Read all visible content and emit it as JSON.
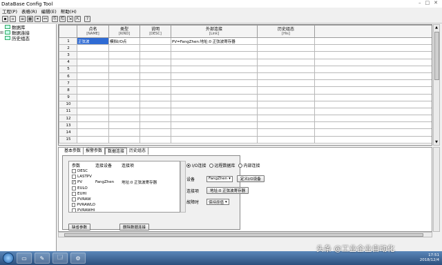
{
  "window": {
    "title": "DataBase Config Tool",
    "min": "–",
    "max": "□",
    "close": "✕"
  },
  "menu": [
    "工程(P)",
    "表格(R)",
    "编辑(E)",
    "帮助(H)"
  ],
  "toolbar_icons": [
    "save-icon",
    "print-icon",
    "list-icon",
    "grid-icon",
    "link-icon",
    "unlink-icon",
    "copy-icon",
    "paste-icon",
    "import-icon",
    "export-icon",
    "help-icon"
  ],
  "toolbar_glyphs": [
    "▪",
    "▫",
    "≡",
    "▦",
    "⚭",
    "⚯",
    "⎘",
    "⎗",
    "⇲",
    "⇱",
    "?"
  ],
  "tree": [
    {
      "label": "数据库",
      "expander": ""
    },
    {
      "label": "数据连接",
      "expander": "⊞"
    },
    {
      "label": "历史组态",
      "expander": ""
    }
  ],
  "grid": {
    "columns": [
      {
        "title": "点名",
        "sub": "[NAME]"
      },
      {
        "title": "类型",
        "sub": "[KIND]"
      },
      {
        "title": "说明",
        "sub": "[DESC]"
      },
      {
        "title": "外部连接",
        "sub": "[Link]"
      },
      {
        "title": "历史组态",
        "sub": "[His]"
      }
    ],
    "rows": [
      {
        "n": "1",
        "name": "正弦波",
        "kind": "模拟I/O点",
        "desc": "",
        "link": "PV=FangZhen:地址:0 正弦波寄存器",
        "his": ""
      },
      {
        "n": "2",
        "name": "",
        "kind": "",
        "desc": "",
        "link": "",
        "his": ""
      },
      {
        "n": "3",
        "name": "",
        "kind": "",
        "desc": "",
        "link": "",
        "his": ""
      },
      {
        "n": "4",
        "name": "",
        "kind": "",
        "desc": "",
        "link": "",
        "his": ""
      },
      {
        "n": "5",
        "name": "",
        "kind": "",
        "desc": "",
        "link": "",
        "his": ""
      },
      {
        "n": "6",
        "name": "",
        "kind": "",
        "desc": "",
        "link": "",
        "his": ""
      },
      {
        "n": "7",
        "name": "",
        "kind": "",
        "desc": "",
        "link": "",
        "his": ""
      },
      {
        "n": "8",
        "name": "",
        "kind": "",
        "desc": "",
        "link": "",
        "his": ""
      },
      {
        "n": "9",
        "name": "",
        "kind": "",
        "desc": "",
        "link": "",
        "his": ""
      },
      {
        "n": "10",
        "name": "",
        "kind": "",
        "desc": "",
        "link": "",
        "his": ""
      },
      {
        "n": "11",
        "name": "",
        "kind": "",
        "desc": "",
        "link": "",
        "his": ""
      },
      {
        "n": "12",
        "name": "",
        "kind": "",
        "desc": "",
        "link": "",
        "his": ""
      },
      {
        "n": "13",
        "name": "",
        "kind": "",
        "desc": "",
        "link": "",
        "his": ""
      },
      {
        "n": "14",
        "name": "",
        "kind": "",
        "desc": "",
        "link": "",
        "his": ""
      },
      {
        "n": "15",
        "name": "",
        "kind": "",
        "desc": "",
        "link": "",
        "his": ""
      }
    ]
  },
  "tabs": [
    "基本参数",
    "报警参数",
    "数据连接",
    "历史组态"
  ],
  "active_tab": 2,
  "params": {
    "headers": [
      "参数",
      "连接设备",
      "连接项"
    ],
    "rows": [
      {
        "name": "DESC",
        "checked": false,
        "device": "",
        "item": ""
      },
      {
        "name": "LASTPV",
        "checked": false,
        "device": "",
        "item": ""
      },
      {
        "name": "PV",
        "checked": true,
        "device": "FangZhen",
        "item": "地址:0 正弦波寄存器"
      },
      {
        "name": "EULO",
        "checked": false,
        "device": "",
        "item": ""
      },
      {
        "name": "EUHI",
        "checked": false,
        "device": "",
        "item": ""
      },
      {
        "name": "PVRAW",
        "checked": false,
        "device": "",
        "item": ""
      },
      {
        "name": "PVRAWLO",
        "checked": false,
        "device": "",
        "item": ""
      },
      {
        "name": "PVRAWHI",
        "checked": false,
        "device": "",
        "item": ""
      }
    ]
  },
  "link_type": {
    "options": [
      "I/O连接",
      "远程数据库",
      "内部连接"
    ],
    "selected": 0
  },
  "device": {
    "label": "设备",
    "value": "FangZhen",
    "define_button": "定义I/O设备"
  },
  "link_item": {
    "label": "连接项",
    "value": "地址:0 正弦波寄存器"
  },
  "fault": {
    "label": "故障时",
    "value": "保持原值"
  },
  "buttons": {
    "default_params": "缺省参数",
    "delete_link": "删除数据连接"
  },
  "scroll_glyphs": {
    "up": "▲",
    "down": "▼",
    "select": "▾"
  },
  "taskbar": {
    "apps": [
      "▭",
      "✎",
      "🗔",
      "⚙"
    ],
    "clock_time": "17:51",
    "clock_date": "2018/12/4"
  },
  "watermark": "头条 @工业企业自动化"
}
